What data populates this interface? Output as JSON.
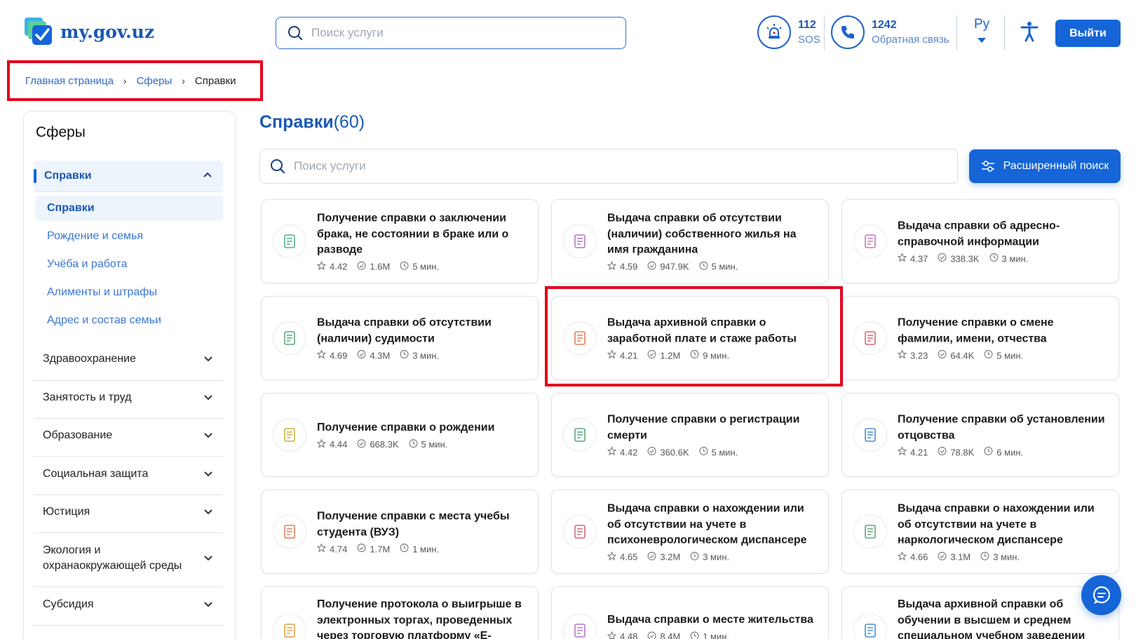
{
  "header": {
    "logo_text": "my.gov.uz",
    "search_placeholder": "Поиск услуги",
    "sos": {
      "number": "112",
      "label": "SOS"
    },
    "feedback": {
      "number": "1242",
      "label": "Обратная связь"
    },
    "language": "Ру",
    "logout_label": "Выйти"
  },
  "breadcrumb": {
    "items": [
      "Главная страница",
      "Сферы"
    ],
    "current": "Справки",
    "separator": "›"
  },
  "sidebar": {
    "title": "Сферы",
    "active_section": "Справки",
    "subitems": [
      "Справки",
      "Рождение и семья",
      "Учёба и работа",
      "Алименты и штрафы",
      "Адрес и состав семьи"
    ],
    "sections": [
      "Здравоохранение",
      "Занятость и труд",
      "Образование",
      "Социальная защита",
      "Юстиция",
      "Экология и охранаокружающей среды",
      "Субсидия"
    ]
  },
  "main": {
    "title": "Справки",
    "count": "(60)",
    "search_placeholder": "Поиск услуги",
    "advanced_search_label": "Расширенный поиск"
  },
  "cards": [
    {
      "title": "Получение справки о заключении брака, не состоянии в браке или о разводе",
      "rating": "4.42",
      "uses": "1.6M",
      "time": "5 мин.",
      "icon": "document-icon"
    },
    {
      "title": "Выдача справки об отсутствии (наличии) собственного жилья на имя гражданина",
      "rating": "4.59",
      "uses": "947.9K",
      "time": "5 мин.",
      "icon": "house-search-icon"
    },
    {
      "title": "Выдача справки об адресно-справочной информации",
      "rating": "4.37",
      "uses": "338.3K",
      "time": "3 мин.",
      "icon": "house-icon"
    },
    {
      "title": "Выдача справки об отсутствии (наличии) судимости",
      "rating": "4.69",
      "uses": "4.3M",
      "time": "3 мин.",
      "icon": "person-icon"
    },
    {
      "title": "Выдача архивной справки о заработной плате и стаже работы",
      "rating": "4.21",
      "uses": "1.2M",
      "time": "9 мин.",
      "icon": "calendar-salary-icon"
    },
    {
      "title": "Получение справки о смене фамилии, имени, отчества",
      "rating": "3.23",
      "uses": "64.4K",
      "time": "5 мин.",
      "icon": "form-icon"
    },
    {
      "title": "Получение справки о рождении",
      "rating": "4.44",
      "uses": "668.3K",
      "time": "5 мин.",
      "icon": "baby-icon"
    },
    {
      "title": "Получение справки о регистрации смерти",
      "rating": "4.42",
      "uses": "360.6K",
      "time": "5 мин.",
      "icon": "certificate-icon"
    },
    {
      "title": "Получение справки об установлении отцовства",
      "rating": "4.21",
      "uses": "78.8K",
      "time": "6 мин.",
      "icon": "family-icon"
    },
    {
      "title": "Получение справки с места учебы студента (ВУЗ)",
      "rating": "4.74",
      "uses": "1.7M",
      "time": "1 мин.",
      "icon": "graduation-cap-icon"
    },
    {
      "title": "Выдача справки о нахождении или об отсутствии на учете в психоневрологическом диспансере",
      "rating": "4.65",
      "uses": "3.2M",
      "time": "3 мин.",
      "icon": "document-search-icon"
    },
    {
      "title": "Выдача справки о нахождении или об отсутствии на учете в наркологическом диспансере",
      "rating": "4.66",
      "uses": "3.1M",
      "time": "3 мин.",
      "icon": "document-search-icon"
    },
    {
      "title": "Получение протокола о выигрыше в электронных торгах, проведенных через торговую платформу «E-",
      "rating": "",
      "uses": "",
      "time": "",
      "icon": "money-document-icon"
    },
    {
      "title": "Выдача справки о месте жительства",
      "rating": "4.48",
      "uses": "8.4M",
      "time": "1 мин.",
      "icon": "clipboard-icon"
    },
    {
      "title": "Выдача архивной справки об обучении в высшем и среднем специальном учебном заведении",
      "rating": "",
      "uses": "",
      "time": "",
      "icon": "book-icon"
    }
  ],
  "colors": {
    "primary": "#1565d8",
    "highlight": "#e3001b",
    "link": "#2e6bc6"
  }
}
